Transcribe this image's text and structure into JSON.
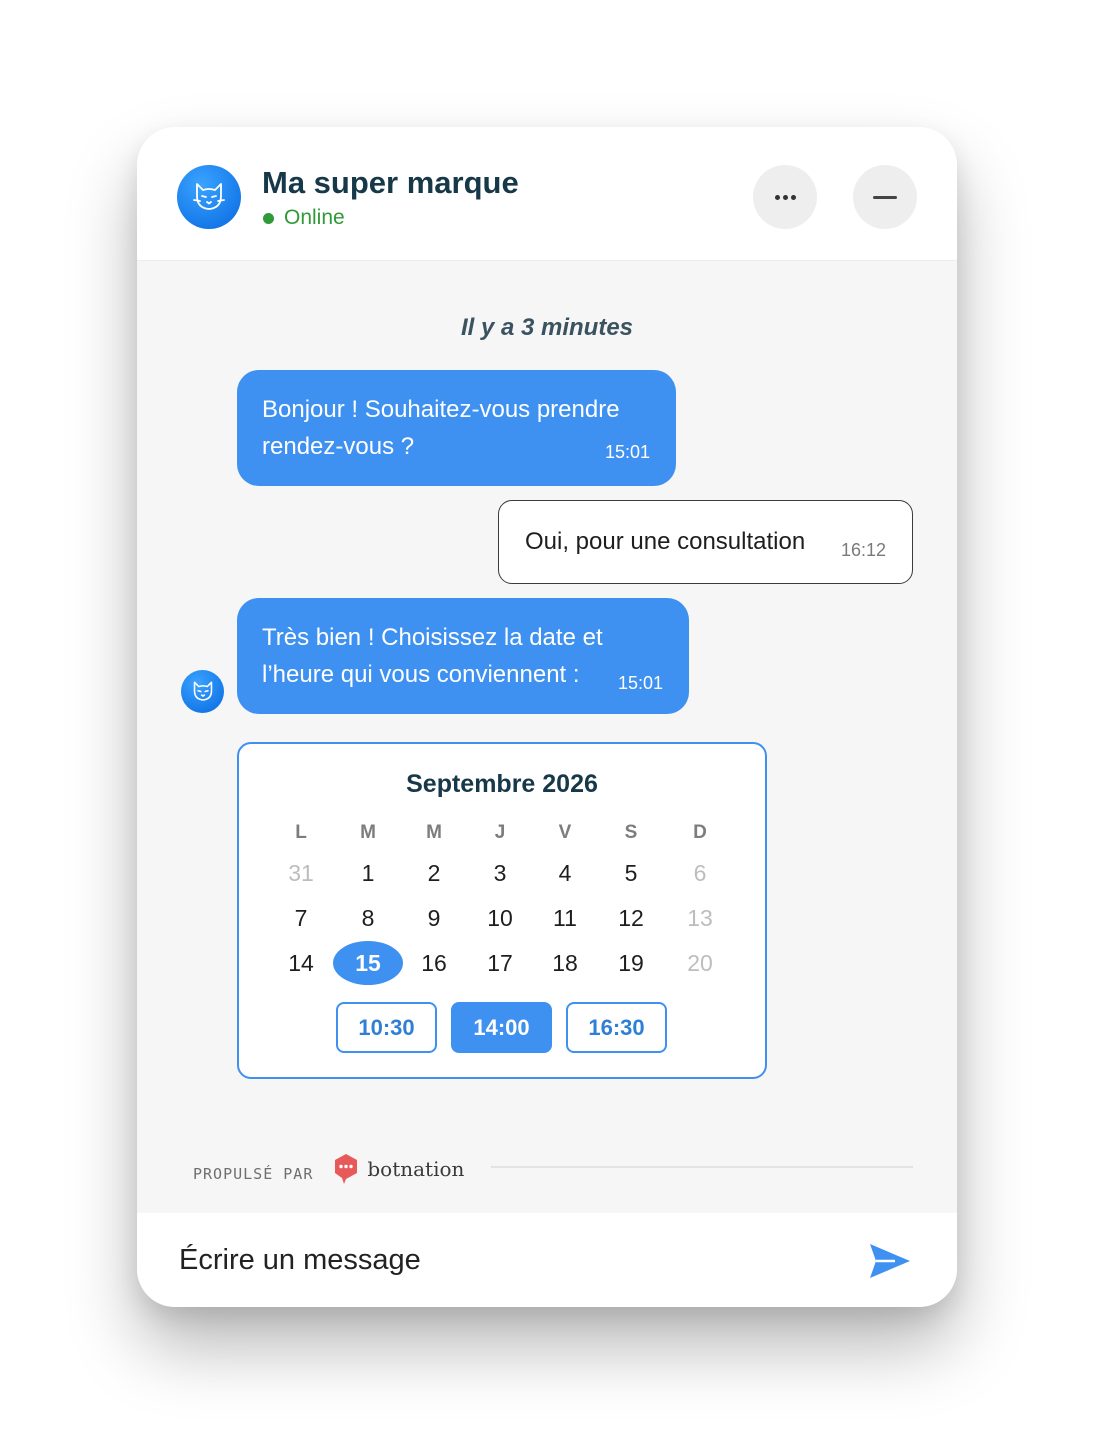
{
  "header": {
    "brand_name": "Ma super marque",
    "status": "Online"
  },
  "chat": {
    "time_separator": "Il y a 3 minutes",
    "messages": [
      {
        "from": "bot",
        "text": "Bonjour ! Souhaitez-vous prendre rendez-vous ?",
        "time": "15:01"
      },
      {
        "from": "user",
        "text": "Oui, pour une consultation",
        "time": "16:12"
      },
      {
        "from": "bot",
        "text": "Très bien ! Choisissez la date et l’heure qui vous conviennent :",
        "time": "15:01"
      }
    ]
  },
  "calendar": {
    "title": "Septembre 2026",
    "weekdays": [
      "L",
      "M",
      "M",
      "J",
      "V",
      "S",
      "D"
    ],
    "weeks": [
      [
        "31",
        "1",
        "2",
        "3",
        "4",
        "5",
        "6"
      ],
      [
        "7",
        "8",
        "9",
        "10",
        "11",
        "12",
        "13"
      ],
      [
        "14",
        "15",
        "16",
        "17",
        "18",
        "19",
        "20"
      ]
    ],
    "selected_day": "15",
    "slots": [
      "10:30",
      "14:00",
      "16:30"
    ],
    "active_slot": "14:00"
  },
  "footer": {
    "powered_label": "PROPULSÉ PAR",
    "powered_brand": "botnation"
  },
  "composer": {
    "placeholder": "Écrire un message"
  },
  "colors": {
    "accent": "#3e91f0",
    "brand_text": "#173848",
    "online": "#2f9a37",
    "botnation_logo": "#e85a5a"
  },
  "icons": {
    "avatar": "cat-face-icon",
    "more": "more-dots-icon",
    "minimize": "minimize-icon",
    "send": "send-arrow-icon",
    "powered": "botnation-logo-icon"
  }
}
